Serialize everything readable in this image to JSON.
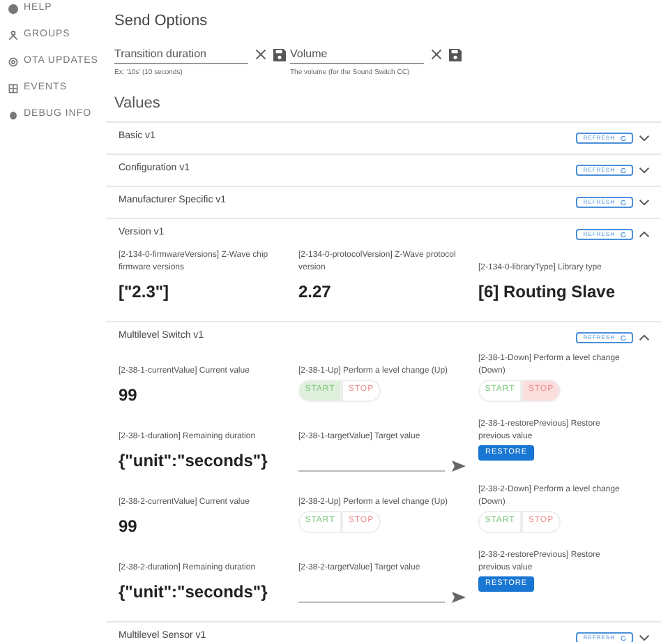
{
  "sidebar": {
    "items": [
      {
        "label": "HELP"
      },
      {
        "label": "GROUPS"
      },
      {
        "label": "OTA UPDATES"
      },
      {
        "label": "EVENTS"
      },
      {
        "label": "DEBUG INFO"
      }
    ]
  },
  "send_options": {
    "title": "Send Options",
    "fields": [
      {
        "placeholder": "Transition duration",
        "hint": "Ex: '10s' (10 seconds)"
      },
      {
        "placeholder": "Volume",
        "hint": "The volume (for the Sound Switch CC)"
      }
    ]
  },
  "values": {
    "title": "Values",
    "panels": [
      {
        "title": "Basic v1",
        "refresh": "REFRESH",
        "expanded": false
      },
      {
        "title": "Configuration v1",
        "refresh": "REFRESH",
        "expanded": false
      },
      {
        "title": "Manufacturer Specific v1",
        "refresh": "REFRESH",
        "expanded": false
      },
      {
        "title": "Version v1",
        "refresh": "REFRESH",
        "expanded": true,
        "items": [
          {
            "kind": "value",
            "label": "[2-134-0-firmwareVersions] Z-Wave chip firmware versions",
            "value": "[\"2.3\"]"
          },
          {
            "kind": "value",
            "label": "[2-134-0-protocolVersion] Z-Wave protocol version",
            "value": "2.27"
          },
          {
            "kind": "value",
            "label": "[2-134-0-libraryType] Library type",
            "value": "[6] Routing Slave"
          }
        ]
      },
      {
        "title": "Multilevel Switch v1",
        "refresh": "REFRESH",
        "expanded": true,
        "items": [
          {
            "kind": "value",
            "label": "[2-38-1-currentValue] Current value",
            "value": "99"
          },
          {
            "kind": "level_change",
            "label": "[2-38-1-Up] Perform a level change (Up)",
            "start": "START",
            "stop": "STOP",
            "start_active": true,
            "stop_active": false
          },
          {
            "kind": "level_change",
            "label": "[2-38-1-Down] Perform a level change (Down)",
            "start": "START",
            "stop": "STOP",
            "start_active": false,
            "stop_active": true
          },
          {
            "kind": "value",
            "label": "[2-38-1-duration] Remaining duration",
            "value": "{\"unit\":\"seconds\"}"
          },
          {
            "kind": "target",
            "label": "[2-38-1-targetValue] Target value"
          },
          {
            "kind": "restore",
            "label": "[2-38-1-restorePrevious] Restore previous value",
            "button": "RESTORE"
          },
          {
            "kind": "value",
            "label": "[2-38-2-currentValue] Current value",
            "value": "99"
          },
          {
            "kind": "level_change",
            "label": "[2-38-2-Up] Perform a level change (Up)",
            "start": "START",
            "stop": "STOP",
            "start_active": false,
            "stop_active": false
          },
          {
            "kind": "level_change",
            "label": "[2-38-2-Down] Perform a level change (Down)",
            "start": "START",
            "stop": "STOP",
            "start_active": false,
            "stop_active": false
          },
          {
            "kind": "value",
            "label": "[2-38-2-duration] Remaining duration",
            "value": "{\"unit\":\"seconds\"}"
          },
          {
            "kind": "target",
            "label": "[2-38-2-targetValue] Target value"
          },
          {
            "kind": "restore",
            "label": "[2-38-2-restorePrevious] Restore previous value",
            "button": "RESTORE"
          }
        ]
      },
      {
        "title": "Multilevel Sensor v1",
        "refresh": "REFRESH",
        "expanded": false
      }
    ]
  }
}
